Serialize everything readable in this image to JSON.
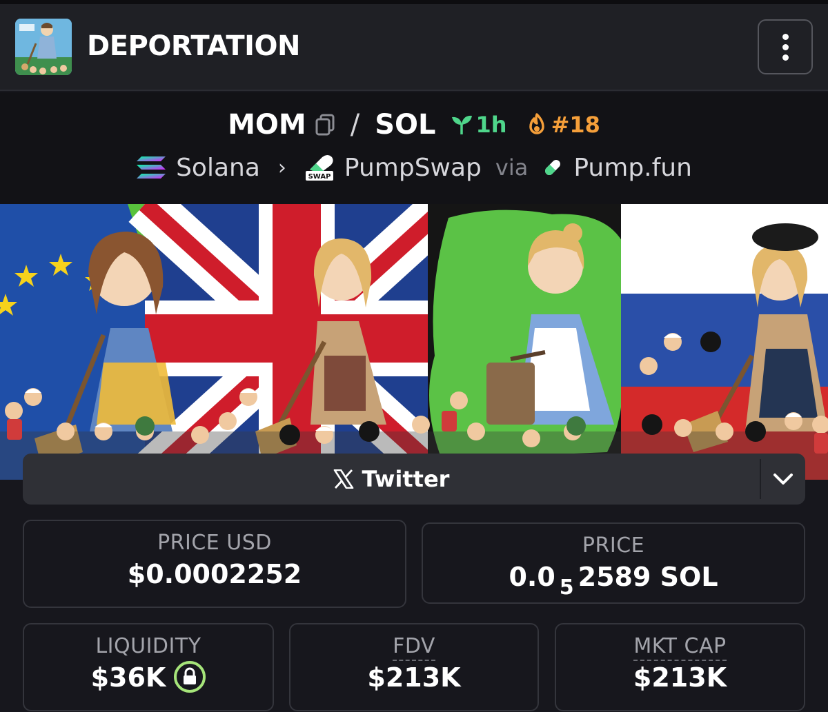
{
  "header": {
    "title": "DEPORTATION",
    "menu_icon": "more-vertical-icon"
  },
  "pair": {
    "base": "MOM",
    "separator": "/",
    "quote": "SOL",
    "age": "1h",
    "rank": "#18"
  },
  "chain": {
    "network": "Solana",
    "dex": "PumpSwap",
    "dex_badge": "SWAP",
    "via": "via",
    "launchpad": "Pump.fun"
  },
  "links": {
    "twitter_label": "Twitter"
  },
  "stats": {
    "price_usd_label": "PRICE USD",
    "price_usd_value": "$0.0002252",
    "price_label": "PRICE",
    "price_prefix": "0.0",
    "price_zeros": "5",
    "price_digits": "2589 SOL",
    "liquidity_label": "LIQUIDITY",
    "liquidity_value": "$36K",
    "fdv_label": "FDV",
    "fdv_value": "$213K",
    "mktcap_label": "MKT CAP",
    "mktcap_value": "$213K"
  },
  "colors": {
    "background": "#17171d",
    "header": "#1f2025",
    "age_green": "#4fd68b",
    "rank_orange": "#f59f3a",
    "lock_green": "#a6e57a"
  }
}
